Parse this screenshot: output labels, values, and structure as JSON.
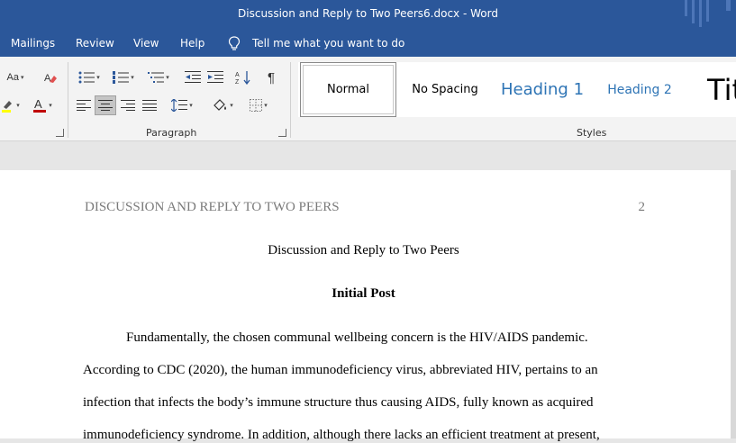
{
  "window": {
    "title": "Discussion and Reply to Two Peers6.docx  -  Word"
  },
  "menu": {
    "items": [
      "Mailings",
      "Review",
      "View",
      "Help"
    ],
    "tell_me": "Tell me what you want to do"
  },
  "ribbon": {
    "font": {
      "change_case_label": "Aa"
    },
    "paragraph": {
      "label": "Paragraph"
    },
    "styles": {
      "label": "Styles",
      "items": [
        "Normal",
        "No Spacing",
        "Heading 1",
        "Heading 2",
        "Tit"
      ],
      "selected": "Normal"
    },
    "colors": {
      "font_color": "#c00000",
      "highlight": "#ffff00"
    }
  },
  "document": {
    "header_text": "DISCUSSION AND REPLY TO TWO PEERS",
    "page_number": "2",
    "title": "Discussion and Reply to Two Peers",
    "heading": "Initial Post",
    "body_lines": [
      "Fundamentally, the chosen communal wellbeing concern is the HIV/AIDS pandemic.",
      "According to CDC (2020), the human immunodeficiency virus, abbreviated HIV, pertains to an",
      "infection that infects the body’s immune structure thus causing AIDS, fully known as acquired",
      "immunodeficiency syndrome. In addition, although there lacks an efficient treatment at present,"
    ]
  }
}
